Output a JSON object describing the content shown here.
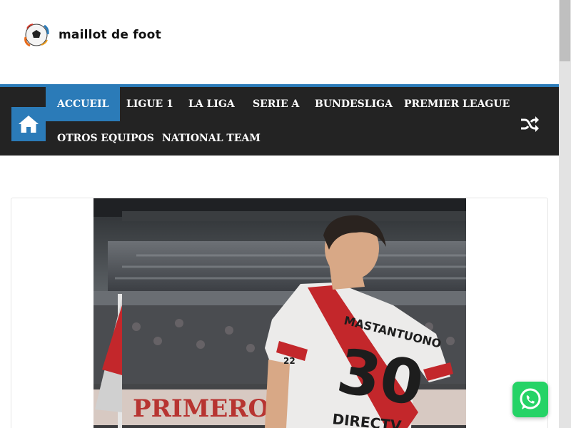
{
  "site": {
    "name": "maillot de foot"
  },
  "nav": {
    "home_icon": "home-icon",
    "items": [
      {
        "label": "ACCUEIL",
        "active": true
      },
      {
        "label": "LIGUE 1",
        "active": false
      },
      {
        "label": "LA LIGA",
        "active": false
      },
      {
        "label": "SERIE A",
        "active": false
      },
      {
        "label": "BUNDESLIGA",
        "active": false
      },
      {
        "label": "PREMIER LEAGUE",
        "active": false
      },
      {
        "label": "OTROS EQUIPOS",
        "active": false
      },
      {
        "label": "NATIONAL TEAM",
        "active": false
      }
    ],
    "shuffle_icon": "shuffle-icon"
  },
  "article": {
    "image": {
      "jersey_name": "MASTANTUONO",
      "jersey_number": "30",
      "sleeve_number": "22",
      "sponsor": "DIRECTV",
      "banner_text": "PRIMERO"
    }
  },
  "floating": {
    "whatsapp_icon": "whatsapp-icon"
  },
  "colors": {
    "accent": "#2b7bb8",
    "nav_background": "#232323",
    "whatsapp": "#25d366"
  }
}
